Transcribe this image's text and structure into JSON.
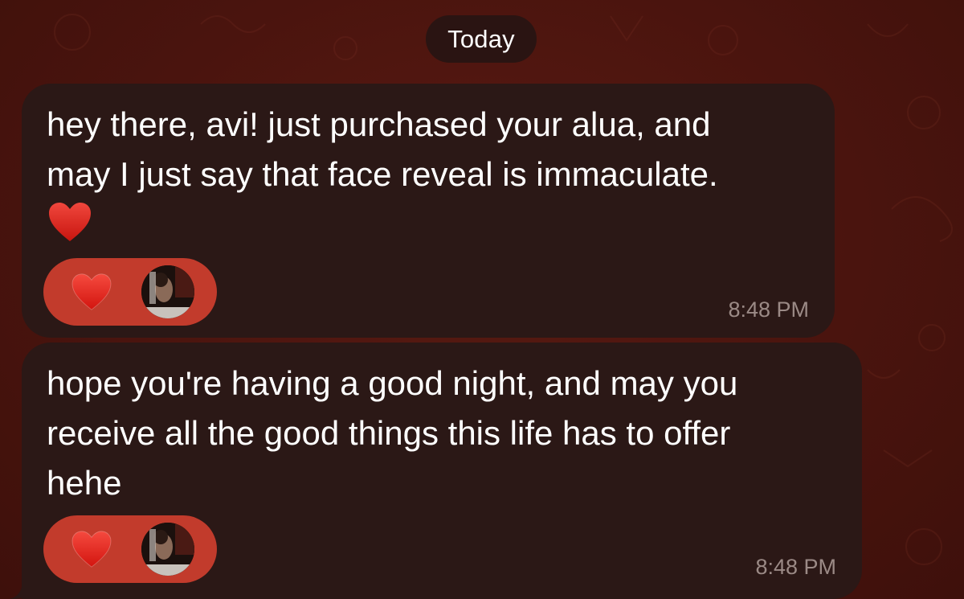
{
  "chat": {
    "date_label": "Today",
    "messages": [
      {
        "text": "hey there, avi! just purchased your alua, and\nmay I just say that face reveal is immaculate.",
        "inline_emoji": "heart-icon",
        "reaction": "heart-icon",
        "time": "8:48 PM"
      },
      {
        "text": "hope you're having a good night, and may you\nreceive all the good things this life has to offer\nhehe",
        "reaction": "heart-icon",
        "time": "8:48 PM"
      }
    ]
  },
  "colors": {
    "background": "#4a140e",
    "bubble": "#2b1816",
    "reaction_pill": "#c23b2c",
    "heart": "#e0241f",
    "timestamp": "#9b8a86"
  }
}
